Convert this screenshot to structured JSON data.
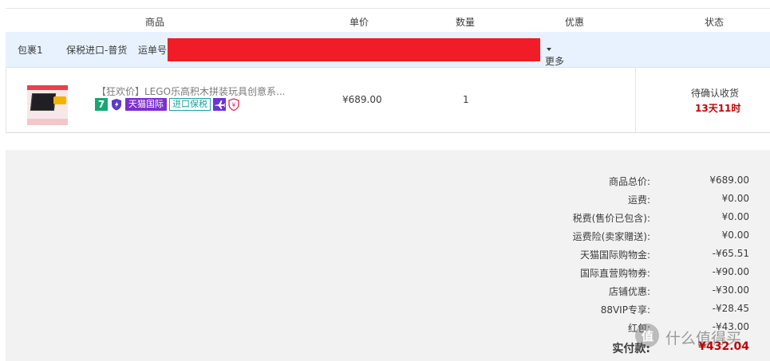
{
  "header": {
    "col_product": "商品",
    "col_price": "单价",
    "col_qty": "数量",
    "col_discount": "优惠",
    "col_status": "状态"
  },
  "package": {
    "name": "包裹1",
    "shipping_type": "保税进口-普货",
    "tracking_label": "运单号",
    "more_label": "更多",
    "redaction_color": "#f01c28"
  },
  "item": {
    "title": "【狂欢价】LEGO乐高积木拼装玩具创意系...",
    "badges": {
      "seven": "7",
      "tmall_global": "天猫国际",
      "bonded": "进口保税"
    },
    "badge_icons": [
      "seven-day-return-icon",
      "shield-check-icon",
      "tmall-global-badge",
      "bonded-import-badge",
      "plane-icon",
      "yen-shield-icon"
    ],
    "price": "¥689.00",
    "quantity": "1",
    "status": "待确认收货",
    "countdown": "13天11时"
  },
  "summary": {
    "rows": [
      {
        "label": "商品总价:",
        "value": "¥689.00"
      },
      {
        "label": "运费:",
        "value": "¥0.00"
      },
      {
        "label": "税费(售价已包含):",
        "value": "¥0.00"
      },
      {
        "label": "运费险(卖家赠送):",
        "value": "¥0.00"
      },
      {
        "label": "天猫国际购物金:",
        "value": "-¥65.51"
      },
      {
        "label": "国际直营购物券:",
        "value": "-¥90.00"
      },
      {
        "label": "店铺优惠:",
        "value": "-¥30.00"
      },
      {
        "label": "88VIP专享:",
        "value": "-¥28.45"
      },
      {
        "label": "红包:",
        "value": "-¥43.00"
      }
    ],
    "total_label": "实付款:",
    "total_value": "¥432.04"
  },
  "watermark": {
    "icon_text": "值",
    "text": "什么值得买"
  },
  "colors": {
    "accent_red": "#c40000",
    "package_bar_bg": "#e8f2ff",
    "summary_bg": "#f2f2f2"
  }
}
